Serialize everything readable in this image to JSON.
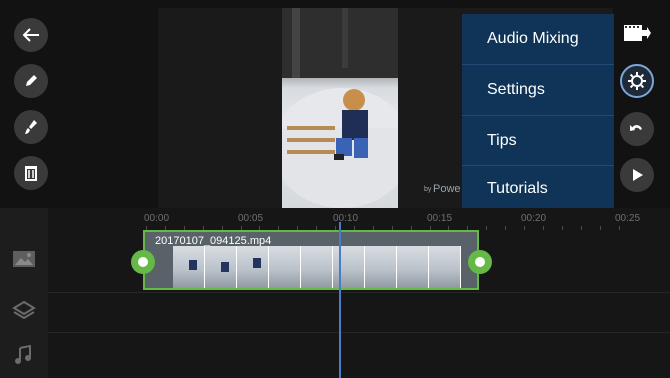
{
  "menu": {
    "items": [
      {
        "label": "Audio Mixing"
      },
      {
        "label": "Settings"
      },
      {
        "label": "Tips"
      },
      {
        "label": "Tutorials"
      }
    ]
  },
  "preview": {
    "watermark_prefix": "by",
    "watermark_brand": "Powe"
  },
  "timeline": {
    "ruler_labels": [
      "00:00",
      "00:05",
      "00:10",
      "00:15",
      "00:20",
      "00:25"
    ],
    "clip_name": "20170107_094125.mp4"
  },
  "colors": {
    "accent_green": "#66b946",
    "playhead_blue": "#4a7bc6",
    "menu_bg": "#103457"
  },
  "icons": {
    "left_toolbar": [
      "back-arrow-icon",
      "pencil-icon",
      "brush-icon",
      "trash-icon"
    ],
    "right_toolbar": [
      "clip-export-icon",
      "gear-icon",
      "undo-icon",
      "play-icon"
    ],
    "track_types": [
      "image-track-icon",
      "layers-icon",
      "music-note-icon"
    ]
  }
}
